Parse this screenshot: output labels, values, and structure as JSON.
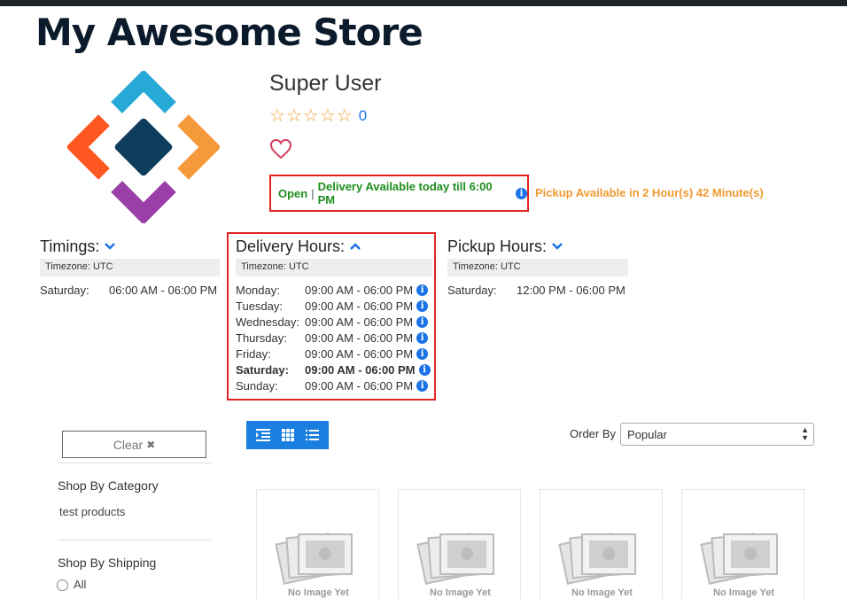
{
  "store": {
    "title": "My Awesome Store"
  },
  "profile": {
    "name": "Super User",
    "rating_count": "0",
    "stars": 5
  },
  "status": {
    "open": "Open",
    "separator": "|",
    "delivery": "Delivery Available today till 6:00 PM",
    "pickup": "Pickup Available in 2 Hour(s) 42 Minute(s)"
  },
  "timings": {
    "heading": "Timings:",
    "timezone": "Timezone: UTC",
    "rows": [
      {
        "day": "Saturday:",
        "time": "06:00 AM - 06:00 PM"
      }
    ]
  },
  "delivery_hours": {
    "heading": "Delivery Hours:",
    "timezone": "Timezone: UTC",
    "rows": [
      {
        "day": "Monday:",
        "time": "09:00 AM - 06:00 PM"
      },
      {
        "day": "Tuesday:",
        "time": "09:00 AM - 06:00 PM"
      },
      {
        "day": "Wednesday:",
        "time": "09:00 AM - 06:00 PM"
      },
      {
        "day": "Thursday:",
        "time": "09:00 AM - 06:00 PM"
      },
      {
        "day": "Friday:",
        "time": "09:00 AM - 06:00 PM"
      },
      {
        "day": "Saturday:",
        "time": "09:00 AM - 06:00 PM",
        "current": true
      },
      {
        "day": "Sunday:",
        "time": "09:00 AM - 06:00 PM"
      }
    ]
  },
  "pickup_hours": {
    "heading": "Pickup Hours:",
    "timezone": "Timezone: UTC",
    "rows": [
      {
        "day": "Saturday:",
        "time": "12:00 PM - 06:00 PM"
      }
    ]
  },
  "sidebar": {
    "clear_label": "Clear",
    "clear_icon": "✖",
    "category_title": "Shop By Category",
    "categories": [
      "test products"
    ],
    "shipping_title": "Shop By Shipping",
    "shipping_options": [
      "All"
    ]
  },
  "toolbar": {
    "order_label": "Order By",
    "order_value": "Popular",
    "views": [
      "list-indent-icon",
      "grid-icon",
      "list-icon"
    ]
  },
  "products": [
    {
      "placeholder": "No Image Yet"
    },
    {
      "placeholder": "No Image Yet"
    },
    {
      "placeholder": "No Image Yet"
    },
    {
      "placeholder": "No Image Yet"
    }
  ],
  "colors": {
    "accent": "#1a7fe0",
    "open_green": "#1e8e1e",
    "pickup_orange": "#f09a30",
    "highlight_red": "#e02424",
    "heart": "#d23c5a"
  }
}
